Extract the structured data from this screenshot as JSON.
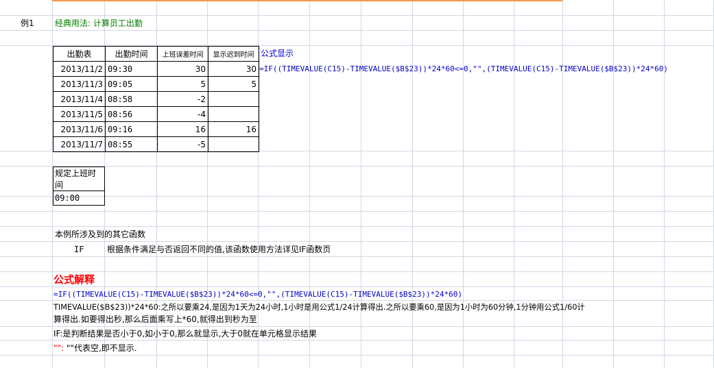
{
  "example_label": "例1",
  "example_title": "经典用法: 计算员工出勤",
  "attendance_table": {
    "headers": [
      "出勤表",
      "出勤时间",
      "上班误差时间",
      "显示迟到时间"
    ],
    "rows": [
      {
        "date": "2013/11/2",
        "time": "09:30",
        "diff": "30",
        "late": "30"
      },
      {
        "date": "2013/11/3",
        "time": "09:05",
        "diff": "5",
        "late": "5"
      },
      {
        "date": "2013/11/4",
        "time": "08:58",
        "diff": "-2",
        "late": ""
      },
      {
        "date": "2013/11/5",
        "time": "08:56",
        "diff": "-4",
        "late": ""
      },
      {
        "date": "2013/11/6",
        "time": "09:16",
        "diff": "16",
        "late": "16"
      },
      {
        "date": "2013/11/7",
        "time": "08:55",
        "diff": "-5",
        "late": ""
      }
    ]
  },
  "formula_display_label": "公式显示",
  "formula_display_text": "=IF((TIMEVALUE(C15)-TIMEVALUE($B$23))*24*60<=0,\"\",(TIMEVALUE(C15)-TIMEVALUE($B$23))*24*60)",
  "standard_time": {
    "label": "规定上班时间",
    "value": "09:00"
  },
  "other_functions_heading": "本例所涉及到的其它函数",
  "other_functions": [
    {
      "name": "IF",
      "description": "根据条件满足与否返回不同的值,该函数使用方法详见IF函数页"
    }
  ],
  "explanation_heading": "公式解释",
  "explanation_formula": "=IF((TIMEVALUE(C15)-TIMEVALUE($B$23))*24*60<=0,\"\",(TIMEVALUE(C15)-TIMEVALUE($B$23))*24*60)",
  "explanation_lines": {
    "line1": "TIMEVALUE($B$23))*24*60:之所以要乘24,是因为1天为24小时,1小时是用公式1/24计算得出.之所以要乘60,是因为1小时为60分钟,1分钟用公式1/60计",
    "line2": "算得出.如要得出秒,那么后面乘写上*60,就得出到秒为至",
    "line3": "IF:是判断结果是否小于0,如小于0,那么就显示,大于0就在单元格显示结果",
    "line4_red": "\"\":",
    "line4_rest": " \"\"代表空,即不显示."
  },
  "colors": {
    "grid": "#d0d7e5",
    "title_green": "#008000",
    "formula_blue": "#0000cc",
    "heading_red": "#ff0000",
    "top_accent": "#f79646"
  }
}
